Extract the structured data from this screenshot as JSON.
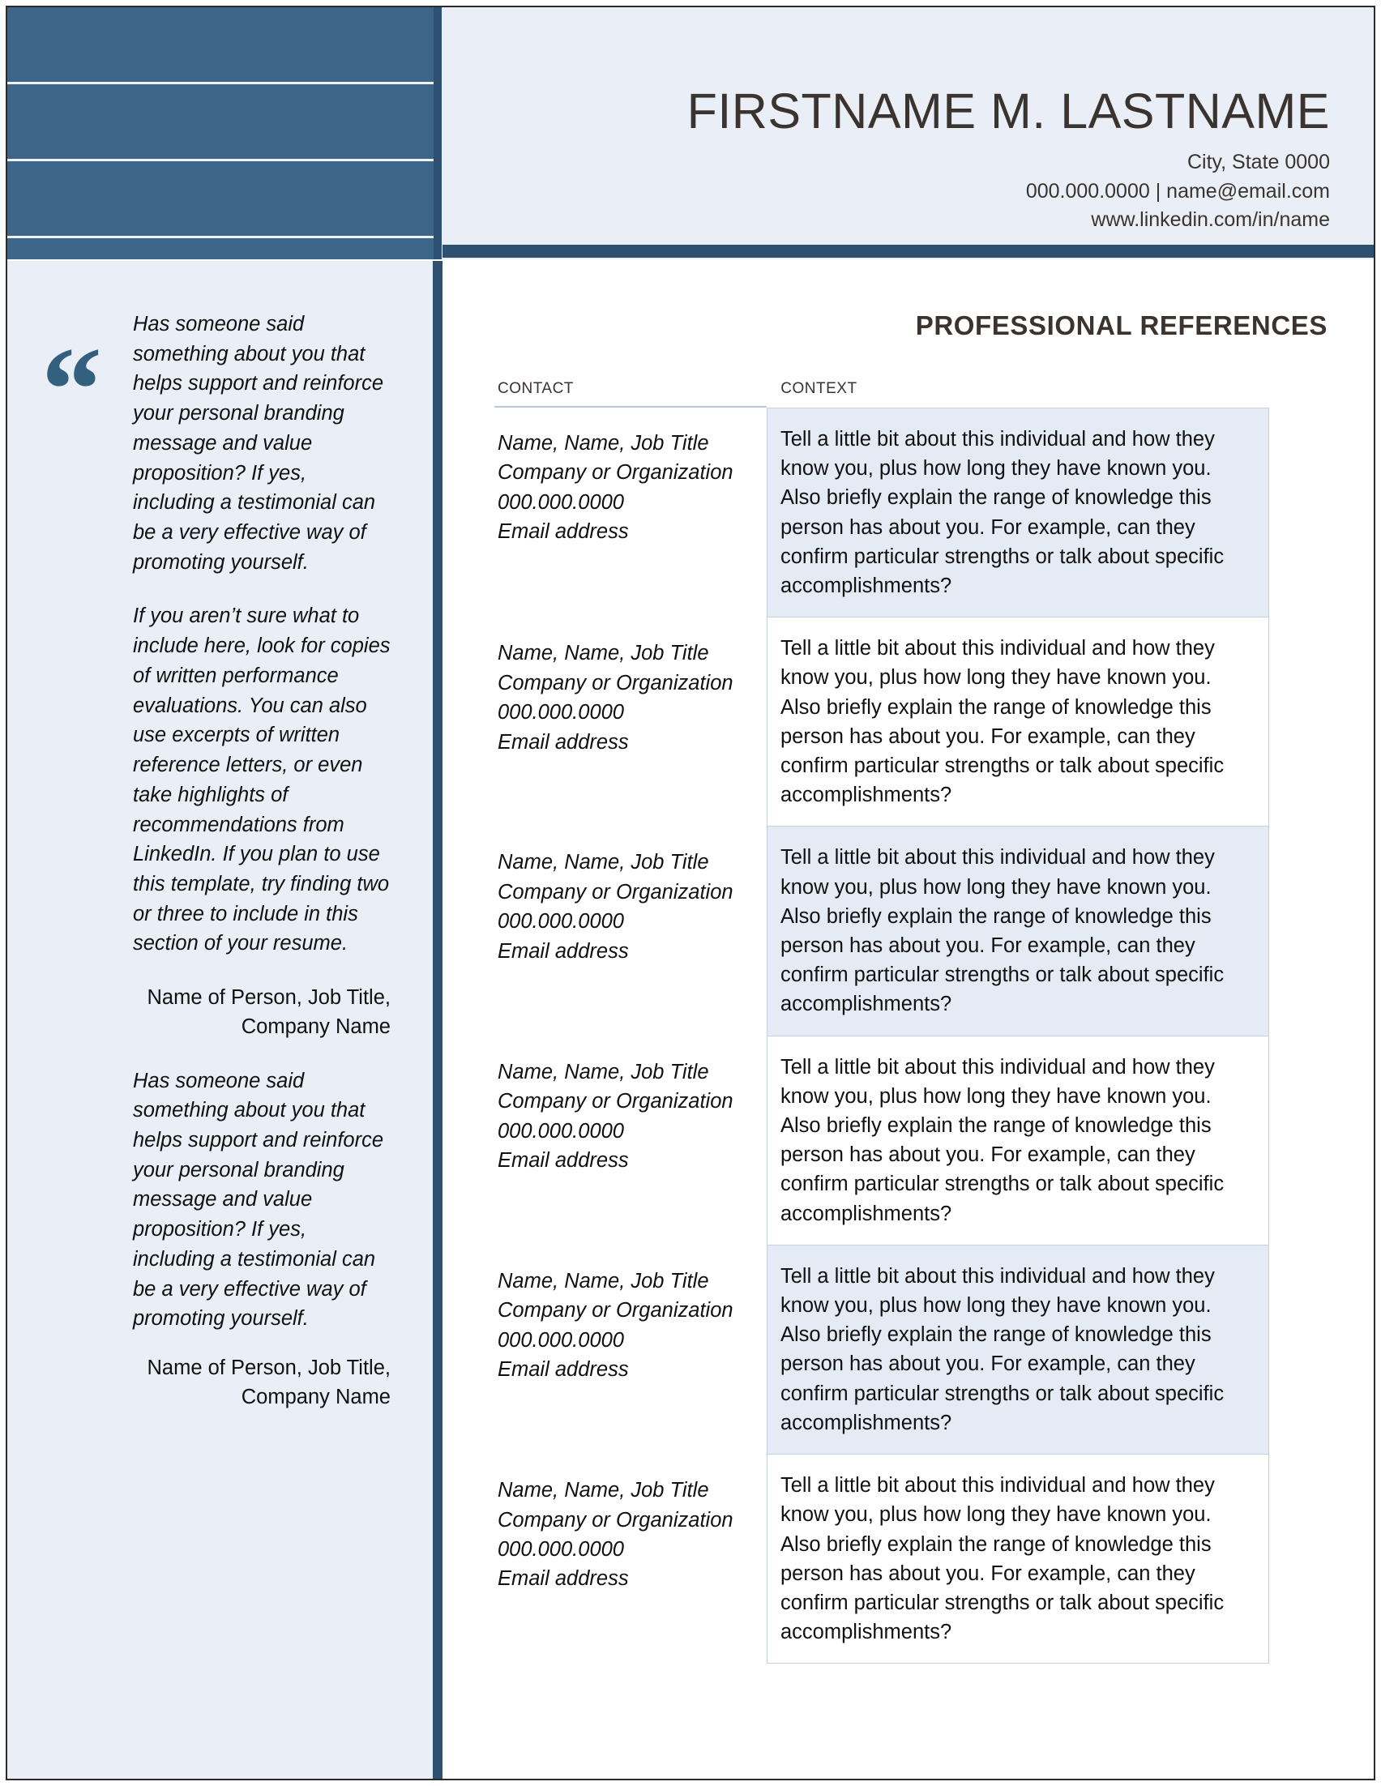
{
  "header": {
    "name": "FIRSTNAME M. LASTNAME",
    "location": "City, State 0000",
    "phone_email": "000.000.0000 | name@email.com",
    "linkedin": "www.linkedin.com/in/name"
  },
  "sidebar": {
    "quote_glyph": "“",
    "blocks": [
      {
        "text": "Has someone said something about you that helps support and reinforce your personal branding message and value proposition? If yes, including a testimonial can be a very effective way of promoting yourself."
      },
      {
        "text": "If you aren’t sure what to include here, look for copies of written performance evaluations. You can also use excerpts of written reference letters, or even take highlights of recommendations from LinkedIn. If you plan to use this template, try finding two or three to include in this section of your resume."
      }
    ],
    "attribution_1": "Name of Person, Job Title, Company Name",
    "block_3": "Has someone said something about you that helps support and reinforce your personal branding message and value proposition? If yes, including a testimonial can be a very effective way of promoting yourself.",
    "attribution_2": "Name of Person, Job Title, Company Name"
  },
  "main": {
    "section_title": "PROFESSIONAL REFERENCES",
    "columns": {
      "contact": "Contact",
      "context": "Context"
    },
    "rows": [
      {
        "contact": "Name, Name, Job Title\nCompany or Organization\n000.000.0000\nEmail address",
        "context": "Tell a little bit about this individual and how they know you, plus how long they have known you. Also briefly explain the range of knowledge this person has about you. For example, can they confirm particular strengths or talk about specific accomplishments?",
        "shaded": true
      },
      {
        "contact": "Name, Name, Job Title\nCompany or Organization\n000.000.0000\nEmail address",
        "context": "Tell a little bit about this individual and how they know you, plus how long they have known you. Also briefly explain the range of knowledge this person has about you. For example, can they confirm particular strengths or talk about specific accomplishments?",
        "shaded": false
      },
      {
        "contact": "Name, Name, Job Title\nCompany or Organization\n000.000.0000\nEmail address",
        "context": "Tell a little bit about this individual and how they know you, plus how long they have known you. Also briefly explain the range of knowledge this person has about you. For example, can they confirm particular strengths or talk about specific accomplishments?",
        "shaded": true
      },
      {
        "contact": "Name, Name, Job Title\nCompany or Organization\n000.000.0000\nEmail address",
        "context": "Tell a little bit about this individual and how they know you, plus how long they have known you. Also briefly explain the range of knowledge this person has about you. For example, can they confirm particular strengths or talk about specific accomplishments?",
        "shaded": false
      },
      {
        "contact": "Name, Name, Job Title\nCompany or Organization\n000.000.0000\nEmail address",
        "context": "Tell a little bit about this individual and how they know you, plus how long they have known you. Also briefly explain the range of knowledge this person has about you. For example, can they confirm particular strengths or talk about specific accomplishments?",
        "shaded": true
      },
      {
        "contact": "Name, Name, Job Title\nCompany or Organization\n000.000.0000\nEmail address",
        "context": "Tell a little bit about this individual and how they know you, plus how long they have known you. Also briefly explain the range of knowledge this person has about you. For example, can they confirm particular strengths or talk about specific accomplishments?",
        "shaded": false
      }
    ]
  },
  "colors": {
    "accent_dark": "#2f5171",
    "accent_mid": "#4d7ca8",
    "quote_blue": "#33607f",
    "panel_bg": "#e9eef7",
    "row_shade": "#e5ebf5",
    "row_border": "#c3d0e0",
    "text_dark": "#3b332e"
  }
}
